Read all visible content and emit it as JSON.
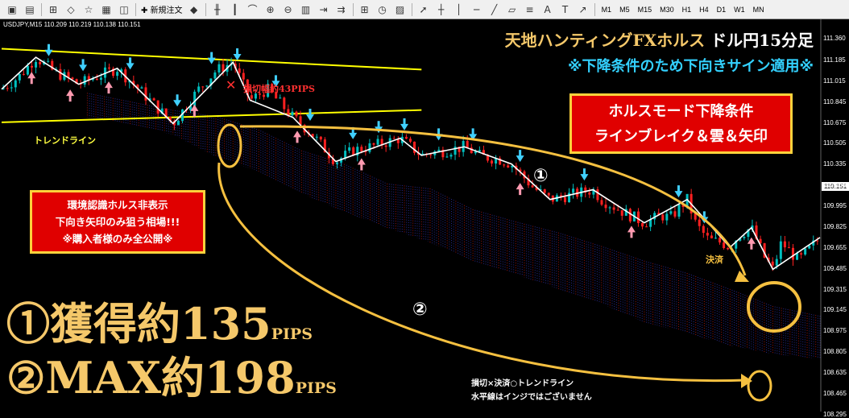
{
  "toolbar": {
    "new_order": "新規注文",
    "timeframes": [
      "M1",
      "M5",
      "M15",
      "M30",
      "H1",
      "H4",
      "D1",
      "W1",
      "MN"
    ]
  },
  "chart_header": {
    "symbol": "USDJPY,M15",
    "quote": "110.209 110.219 110.138 110.151"
  },
  "overlay": {
    "title_gold": "天地ハンティングFXホルス",
    "title_white": "ドル円15分足",
    "subtitle": "※下降条件のため下向きサイン適用※",
    "box_right": [
      "ホルスモード下降条件",
      "ラインブレイク＆雲＆矢印"
    ],
    "box_left": [
      "環境認識ホルス非表示",
      "下向き矢印のみ狙う相場!!!",
      "※購入者様のみ全公開※"
    ],
    "result1_main": "①獲得約135",
    "result1_unit": "PIPS",
    "result2_main": "②MAX約198",
    "result2_unit": "PIPS",
    "stoploss_note": "損切幅約43PIPS",
    "trendline_label": "トレンドライン",
    "circle1_label": "①",
    "circle2_label": "②",
    "settle_label": "決済",
    "bottom_note1": "損切×決済○トレンドライン",
    "bottom_note2": "水平線はインジではございません",
    "x_mark": "✕",
    "current_price": "110.151"
  },
  "chart_data": {
    "type": "line",
    "symbol": "USDJPY,M15",
    "ylabel": "",
    "ylim": [
      108.32,
      111.52
    ],
    "y_ticks": [
      111.36,
      111.185,
      111.015,
      110.845,
      110.675,
      110.505,
      110.335,
      110.165,
      109.995,
      109.825,
      109.655,
      109.485,
      109.315,
      109.145,
      108.975,
      108.805,
      108.635,
      108.465,
      108.295
    ],
    "zigzag": {
      "x": [
        0,
        8,
        18,
        27,
        40,
        54,
        58,
        68,
        78,
        93,
        98,
        108,
        119,
        128,
        138,
        150,
        160,
        170,
        175,
        180,
        191
      ],
      "y": [
        110.95,
        111.21,
        110.99,
        111.12,
        110.67,
        111.17,
        110.86,
        110.72,
        110.36,
        110.55,
        110.41,
        110.48,
        110.34,
        110.05,
        110.13,
        109.86,
        110.05,
        109.66,
        109.82,
        109.48,
        109.74
      ]
    },
    "price_path": {
      "x": [
        0,
        4,
        8,
        12,
        18,
        22,
        27,
        32,
        40,
        46,
        50,
        54,
        58,
        62,
        68,
        72,
        78,
        82,
        86,
        90,
        93,
        98,
        100,
        104,
        108,
        112,
        116,
        119,
        124,
        128,
        132,
        138,
        140,
        145,
        150,
        154,
        156,
        160,
        162,
        165,
        168,
        170,
        172,
        175,
        178,
        180,
        182,
        186,
        191
      ],
      "y": [
        110.95,
        111.05,
        111.21,
        111.1,
        110.99,
        111.05,
        111.12,
        110.95,
        110.67,
        110.95,
        111.1,
        111.17,
        110.86,
        110.95,
        110.72,
        110.6,
        110.36,
        110.45,
        110.48,
        110.52,
        110.55,
        110.41,
        110.43,
        110.45,
        110.48,
        110.4,
        110.38,
        110.34,
        110.15,
        110.05,
        110.08,
        110.13,
        110.05,
        109.95,
        109.86,
        109.92,
        109.9,
        110.05,
        109.85,
        109.72,
        109.7,
        109.66,
        109.76,
        109.82,
        109.58,
        109.48,
        109.7,
        109.55,
        109.74
      ]
    },
    "down_arrows_x": [
      11,
      19,
      30,
      41,
      49,
      55,
      64,
      72,
      82,
      88,
      94,
      102,
      110,
      121,
      136,
      158,
      164
    ],
    "up_arrows_x": [
      7,
      16,
      25,
      45,
      69,
      84,
      121,
      147,
      175
    ],
    "resistance_line": {
      "x": [
        0,
        98
      ],
      "y": [
        111.28,
        111.11
      ]
    },
    "support_line": {
      "x": [
        0,
        98
      ],
      "y": [
        110.68,
        110.78
      ]
    },
    "cloud_upper": {
      "x": [
        20,
        30,
        40,
        50,
        60,
        70,
        80,
        90,
        100,
        110,
        120,
        130,
        140,
        150,
        160,
        170,
        180,
        191
      ],
      "y": [
        110.92,
        110.85,
        110.78,
        110.73,
        110.62,
        110.45,
        110.34,
        110.18,
        110.14,
        109.97,
        109.87,
        109.78,
        109.67,
        109.55,
        109.45,
        109.32,
        109.18,
        109.1
      ]
    },
    "cloud_lower": {
      "x": [
        20,
        30,
        40,
        50,
        60,
        70,
        80,
        90,
        100,
        110,
        120,
        130,
        140,
        150,
        160,
        170,
        180,
        191
      ],
      "y": [
        110.72,
        110.66,
        110.58,
        110.4,
        110.28,
        110.1,
        109.95,
        109.82,
        109.7,
        109.55,
        109.44,
        109.32,
        109.2,
        109.05,
        108.96,
        108.86,
        108.79,
        108.75
      ]
    },
    "colors": {
      "up_candle": "#00c0c0",
      "down_candle": "#ff2020",
      "zigzag": "#ffffff",
      "trendline": "#ffff00",
      "highlight": "#f5c040",
      "cloud": "#3030a0",
      "down_arrow": "#40d0ff",
      "up_arrow": "#ff9ab0"
    }
  }
}
